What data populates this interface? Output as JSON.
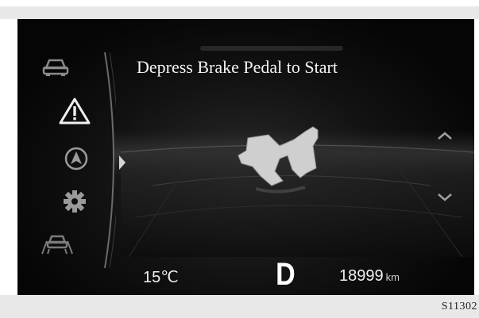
{
  "screen": {
    "message": "Depress Brake Pedal to Start"
  },
  "sidebar": {
    "items": [
      {
        "icon": "car-icon",
        "label": "vehicle"
      },
      {
        "icon": "warning-triangle-icon",
        "label": "warning",
        "active": true
      },
      {
        "icon": "navigation-icon",
        "label": "navigation"
      },
      {
        "icon": "settings-gear-icon",
        "label": "settings"
      },
      {
        "icon": "driver-assist-icon",
        "label": "driver assist"
      }
    ]
  },
  "scroll": {
    "up_icon": "chevron-up-icon",
    "down_icon": "chevron-down-icon"
  },
  "status": {
    "temperature": "15℃",
    "gear": "D",
    "odometer_value": "18999",
    "odometer_unit": "km"
  },
  "footer": {
    "code": "S11302"
  },
  "colors": {
    "background": "#0a0a0a",
    "text": "#f4f4f4",
    "icon": "#bdbdbd"
  }
}
